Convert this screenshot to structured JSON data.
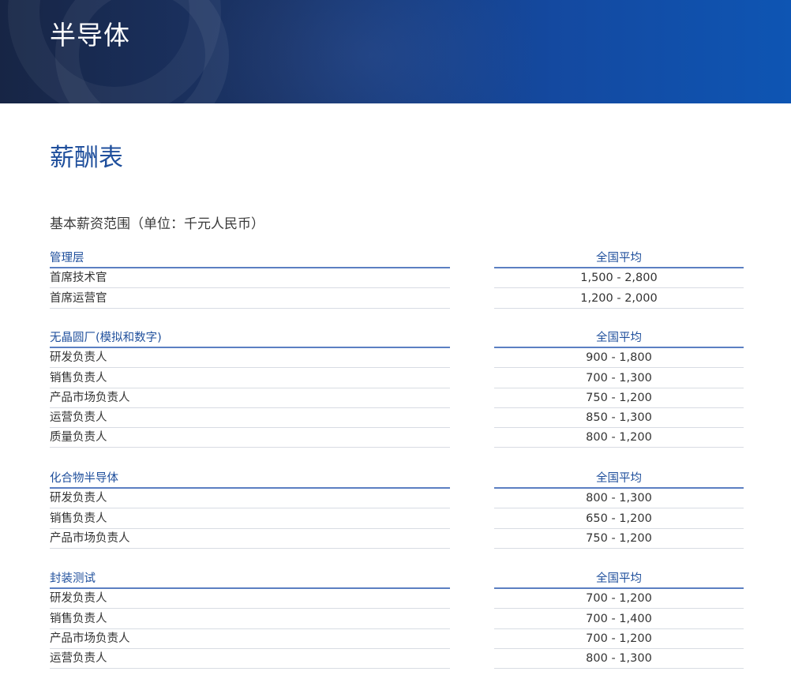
{
  "banner": {
    "title": "半导体"
  },
  "page": {
    "title": "薪酬表",
    "subtitle": "基本薪资范围（单位：千元人民币）"
  },
  "colors": {
    "accent": "#1f4f9c",
    "banner_dark": "#172545",
    "banner_light": "#0e55b3",
    "rule": "#5b7fc2"
  },
  "sections": [
    {
      "name": "管理层",
      "column": "全国平均",
      "rows": [
        {
          "role": "首席技术官",
          "range": "1,500 - 2,800"
        },
        {
          "role": "首席运营官",
          "range": "1,200 - 2,000"
        }
      ]
    },
    {
      "name": "无晶圆厂(模拟和数字)",
      "column": "全国平均",
      "rows": [
        {
          "role": "研发负责人",
          "range": "900 - 1,800"
        },
        {
          "role": "销售负责人",
          "range": "700 - 1,300"
        },
        {
          "role": "产品市场负责人",
          "range": "750 - 1,200"
        },
        {
          "role": "运营负责人",
          "range": "850 - 1,300"
        },
        {
          "role": "质量负责人",
          "range": "800 - 1,200"
        }
      ]
    },
    {
      "name": "化合物半导体",
      "column": "全国平均",
      "rows": [
        {
          "role": "研发负责人",
          "range": "800 - 1,300"
        },
        {
          "role": "销售负责人",
          "range": "650 - 1,200"
        },
        {
          "role": "产品市场负责人",
          "range": "750 - 1,200"
        }
      ]
    },
    {
      "name": "封装测试",
      "column": "全国平均",
      "rows": [
        {
          "role": "研发负责人",
          "range": "700 - 1,200"
        },
        {
          "role": "销售负责人",
          "range": "700 - 1,400"
        },
        {
          "role": "产品市场负责人",
          "range": "700 - 1,200"
        },
        {
          "role": "运营负责人",
          "range": "800 - 1,300"
        }
      ]
    }
  ]
}
